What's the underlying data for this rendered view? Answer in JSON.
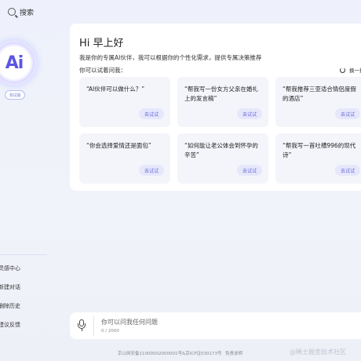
{
  "topbar": {
    "search_label": "搜索"
  },
  "sidebar": {
    "logo_text": "Ai",
    "badge": "测试版",
    "menu": [
      "灵感中心",
      "新建对话",
      "删除历史",
      "建议反馈"
    ]
  },
  "main": {
    "greeting": "Hi 早上好",
    "intro": "我是你的专属AI伙伴，我可以根据你的个性化需求，提供专属决策推荐",
    "try_label": "你可以试着问我：",
    "swap_label": "换一换",
    "prompts": [
      {
        "text": "“AI伙伴可以做什么？”",
        "button": "去试试"
      },
      {
        "text": "“帮我写一份女方父亲在婚礼上的发言稿”",
        "button": "去试试"
      },
      {
        "text": "“帮我推荐三亚适合情侣度假的酒店”",
        "button": "去试试"
      },
      {
        "text": "“你会选择爱情还是面包”",
        "button": "去试试"
      },
      {
        "text": "“如何能让老公体会到怀孕的辛苦”",
        "button": "去试试"
      },
      {
        "text": "“帮我写一首吐槽996的现代诗”",
        "button": "去试试"
      }
    ]
  },
  "input": {
    "placeholder": "你可以问我任何问题",
    "counter": "0 / 2000"
  },
  "footer": {
    "icp": "京公网安备11000002000001号&京ICP证030173号",
    "disclaimer": "免责说明"
  },
  "watermark": "@稀土掘金技术社区"
}
